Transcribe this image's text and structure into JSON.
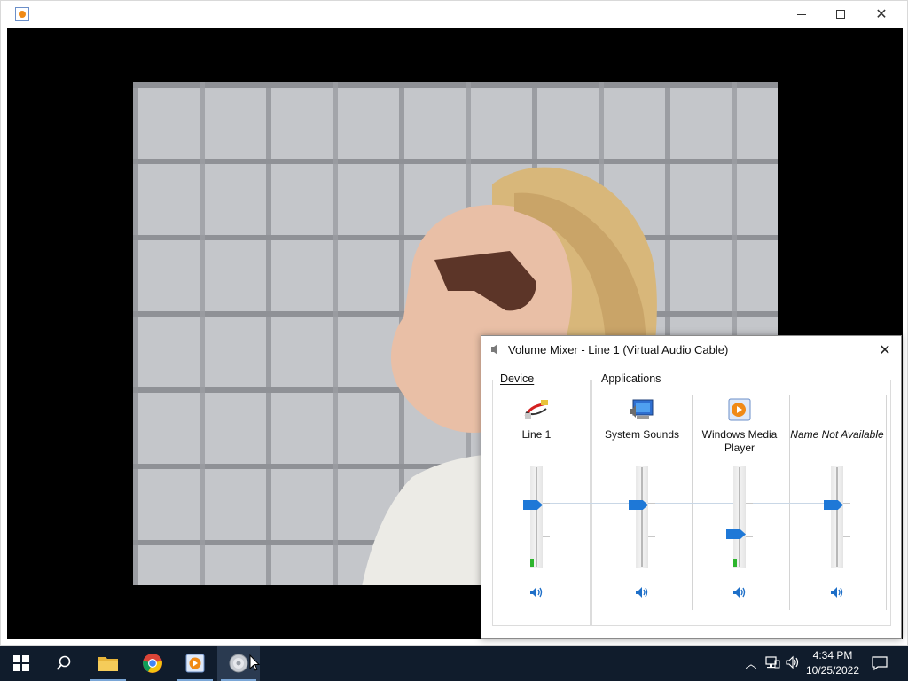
{
  "player_window": {
    "title": "",
    "app_icon": "windows-media-player-icon"
  },
  "mixer": {
    "title": "Volume Mixer - Line 1 (Virtual Audio Cable)",
    "device_group_label": "Device",
    "apps_group_label": "Applications",
    "channels": [
      {
        "name": "Line 1",
        "icon": "audio-cable-icon",
        "level": 0.63,
        "peak": 0.08,
        "italic": false
      },
      {
        "name": "System Sounds",
        "icon": "system-sounds-icon",
        "level": 0.63,
        "peak": 0.0,
        "italic": false
      },
      {
        "name": "Windows Media Player",
        "icon": "windows-media-player-icon",
        "level": 0.31,
        "peak": 0.08,
        "italic": false
      },
      {
        "name": "Name Not Available",
        "icon": "",
        "level": 0.63,
        "peak": 0.0,
        "italic": true
      }
    ]
  },
  "taskbar": {
    "items": [
      {
        "name": "start-button",
        "icon": "windows-logo-icon"
      },
      {
        "name": "search-button",
        "icon": "search-icon"
      },
      {
        "name": "file-explorer",
        "icon": "folder-icon"
      },
      {
        "name": "chrome",
        "icon": "chrome-icon"
      },
      {
        "name": "windows-media-player",
        "icon": "media-player-icon"
      },
      {
        "name": "volume-mixer",
        "icon": "speaker-icon"
      }
    ],
    "clock_time": "4:34 PM",
    "clock_date": "10/25/2022"
  },
  "colors": {
    "accent": "#1e78d7",
    "taskbar": "#101c2c",
    "peak_meter": "#2db52d"
  }
}
